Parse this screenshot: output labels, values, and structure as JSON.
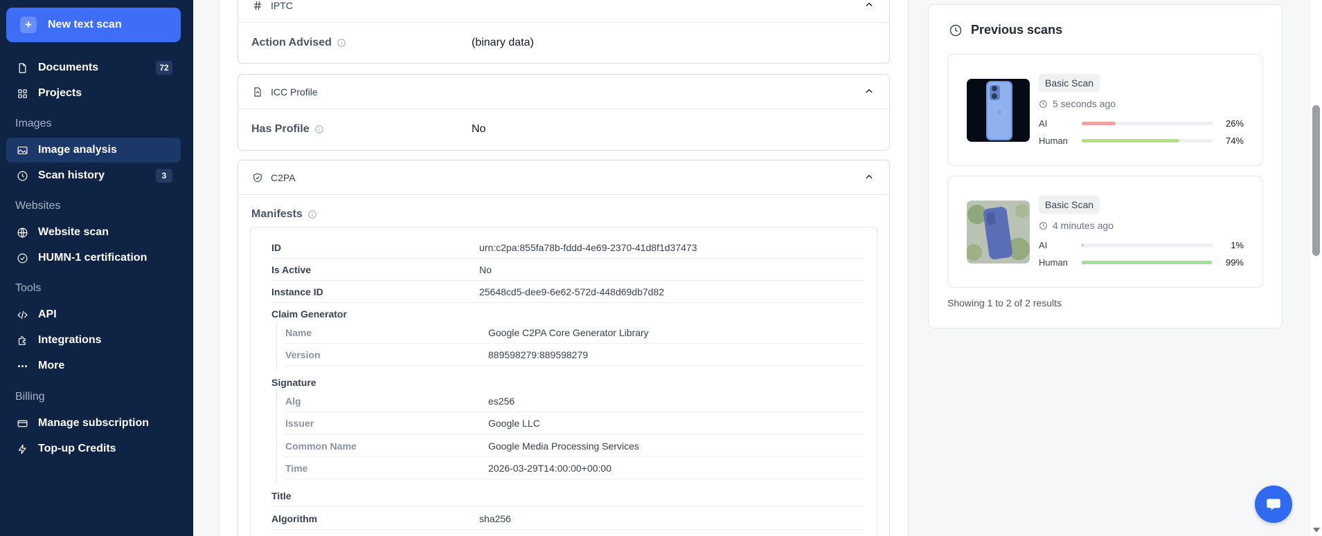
{
  "sidebar": {
    "new_scan_label": "New text scan",
    "items": [
      {
        "label": "Documents",
        "badge": "72"
      },
      {
        "label": "Projects"
      },
      {
        "label": "Image analysis"
      },
      {
        "label": "Scan history",
        "badge": "3"
      },
      {
        "label": "Website scan"
      },
      {
        "label": "HUMN-1 certification"
      },
      {
        "label": "API"
      },
      {
        "label": "Integrations"
      },
      {
        "label": "More"
      },
      {
        "label": "Manage subscription"
      },
      {
        "label": "Top-up Credits"
      }
    ],
    "sections": [
      "Images",
      "Websites",
      "Tools",
      "Billing"
    ]
  },
  "main": {
    "iptc": {
      "title": "IPTC",
      "key": "Action Advised",
      "value": "(binary data)"
    },
    "icc": {
      "title": "ICC Profile",
      "key": "Has Profile",
      "value": "No"
    },
    "c2pa": {
      "title": "C2PA",
      "manifests_label": "Manifests",
      "id": {
        "k": "ID",
        "v": "urn:c2pa:855fa78b-fddd-4e69-2370-41d8f1d37473"
      },
      "is_active": {
        "k": "Is Active",
        "v": "No"
      },
      "instance_id": {
        "k": "Instance ID",
        "v": "25648cd5-dee9-6e62-572d-448d69db7d82"
      },
      "claim_generator": {
        "k": "Claim Generator"
      },
      "cg_name": {
        "k": "Name",
        "v": "Google C2PA Core Generator Library"
      },
      "cg_version": {
        "k": "Version",
        "v": "889598279:889598279"
      },
      "signature": {
        "k": "Signature"
      },
      "sig_alg": {
        "k": "Alg",
        "v": "es256"
      },
      "sig_issuer": {
        "k": "Issuer",
        "v": "Google LLC"
      },
      "sig_common_name": {
        "k": "Common Name",
        "v": "Google Media Processing Services"
      },
      "sig_time": {
        "k": "Time",
        "v": "2026-03-29T14:00:00+00:00"
      },
      "title_row": {
        "k": "Title"
      },
      "algorithm": {
        "k": "Algorithm",
        "v": "sha256"
      }
    }
  },
  "previous_scans": {
    "title": "Previous scans",
    "scans": [
      {
        "type": "Basic Scan",
        "time": "5 seconds ago",
        "ai_label": "AI",
        "ai_pct": "26%",
        "ai_value": 0.26,
        "human_label": "Human",
        "human_pct": "74%",
        "human_value": 0.74
      },
      {
        "type": "Basic Scan",
        "time": "4 minutes ago",
        "ai_label": "AI",
        "ai_pct": "1%",
        "ai_value": 0.01,
        "human_label": "Human",
        "human_pct": "99%",
        "human_value": 0.99
      }
    ],
    "results_text": "Showing 1 to 2 of 2 results"
  },
  "colors": {
    "accent": "#3e6ef5",
    "sidebar_bg": "#0f2344",
    "ai_bar_1": "#f0a0a0",
    "human_bar_1": "#b6e07f",
    "human_bar_2": "#9fe09a"
  }
}
